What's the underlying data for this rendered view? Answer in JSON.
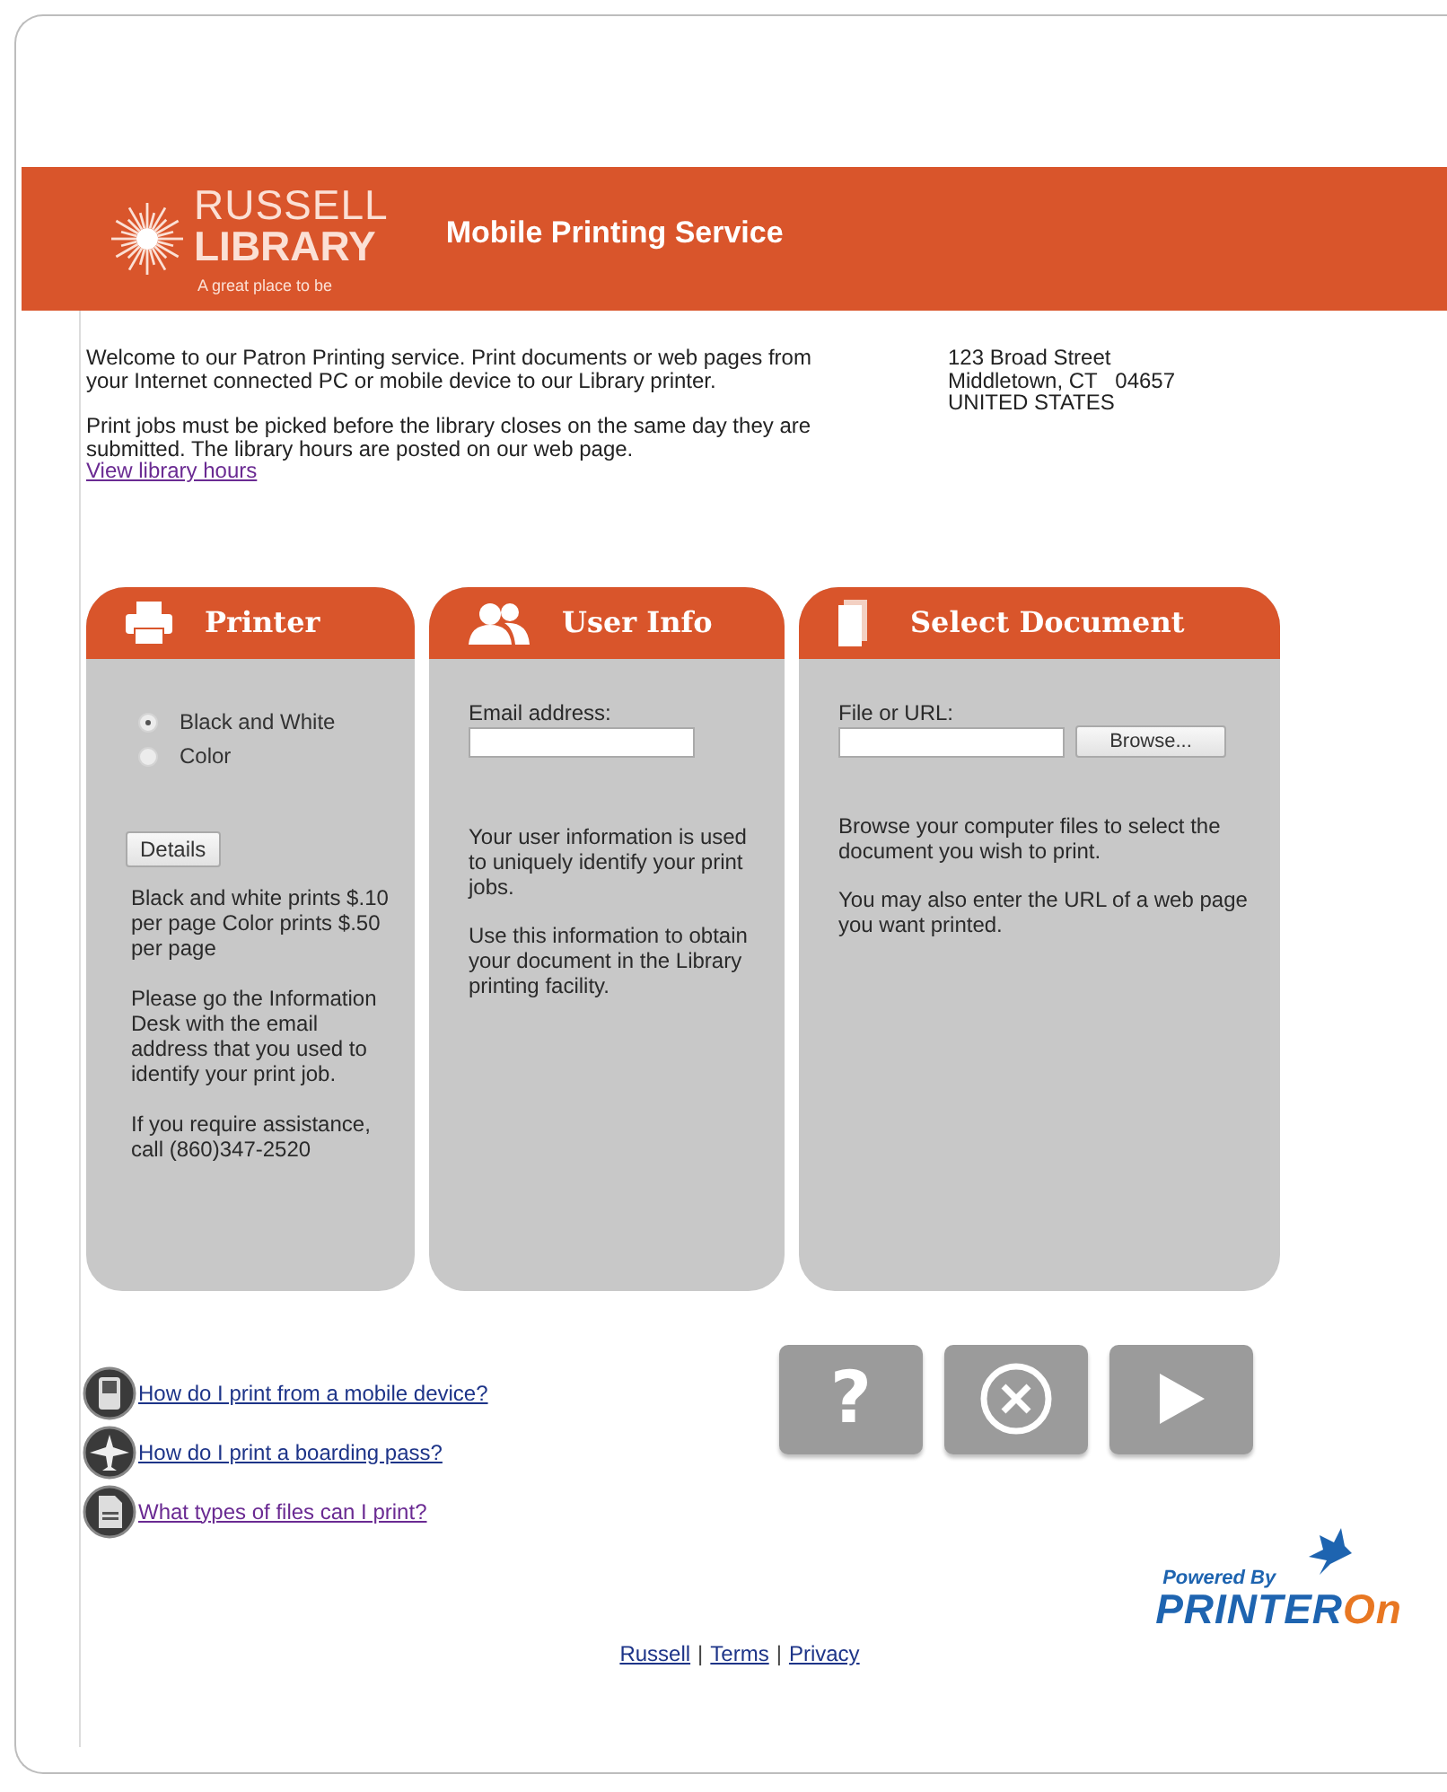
{
  "header": {
    "logo": {
      "line1": "RUSSELL",
      "line2": "LIBRARY",
      "tagline": "A great place to be"
    },
    "title": "Mobile Printing Service"
  },
  "intro": {
    "paragraphs": [
      "Welcome to our Patron Printing service. Print documents or web pages from your Internet connected PC or mobile device to our Library printer.",
      "Print jobs must be picked before the library closes on the same day they are submitted. The library hours are posted on our web page."
    ],
    "link": {
      "text": "View library hours",
      "visited": true
    },
    "address": [
      "123 Broad Street",
      "Middletown, CT   04657",
      "UNITED STATES"
    ]
  },
  "panels": [
    {
      "kind": "printer",
      "title": "Printer",
      "options": [
        {
          "label": "Black and White",
          "selected": true
        },
        {
          "label": "Color",
          "selected": false
        }
      ],
      "button": "Details",
      "notes": [
        "Black and white prints $.10 per page Color prints $.50 per page",
        "Please go the Information Desk with the email address that you used to identify your print job.",
        "If you require assistance, call (860)347-2520"
      ]
    },
    {
      "kind": "user",
      "title": "User Info",
      "field_label": "Email address:",
      "notes": [
        "Your user information is used to uniquely identify your print jobs.",
        "Use this information to obtain your document in the Library printing facility."
      ]
    },
    {
      "kind": "document",
      "title": "Select Document",
      "field_label": "File or URL:",
      "button": "Browse...",
      "notes": [
        "Browse your computer files to select the document you wish to print.",
        "You may also enter the URL of a web page you want printed."
      ]
    }
  ],
  "help_links": [
    {
      "text": "How do I print from a mobile device?",
      "visited": false
    },
    {
      "text": "How do I print a boarding pass?",
      "visited": false
    },
    {
      "text": "What types of files can I print?",
      "visited": true
    }
  ],
  "actions": [
    {
      "kind": "help",
      "text": "?"
    },
    {
      "kind": "cancel"
    },
    {
      "kind": "submit"
    }
  ],
  "powered_by": {
    "label": "Powered By",
    "brand_main": "PRINTER",
    "brand_accent": "On"
  },
  "footer": {
    "links": [
      "Russell",
      "Terms",
      "Privacy"
    ],
    "separator": "|"
  }
}
